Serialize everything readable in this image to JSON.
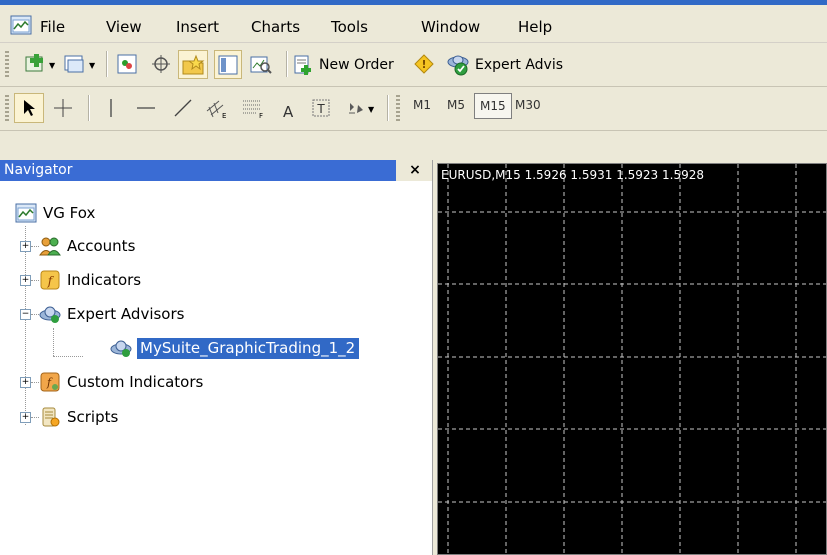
{
  "menubar": {
    "items": [
      "File",
      "View",
      "Insert",
      "Charts",
      "Tools",
      "Window",
      "Help"
    ]
  },
  "toolbar_standard": {
    "new_order_label": "New Order",
    "expert_advisors_label": "Expert Advis"
  },
  "toolbar_periods": {
    "periods": [
      "M1",
      "M5",
      "M15",
      "M30"
    ],
    "active_period": "M15",
    "text_tool_label": "A"
  },
  "navigator": {
    "title": "Navigator",
    "close_glyph": "×",
    "root": "VG Fox",
    "items": [
      {
        "label": "Accounts",
        "icon": "accounts-icon",
        "expander": "+"
      },
      {
        "label": "Indicators",
        "icon": "indicators-icon",
        "expander": "+"
      },
      {
        "label": "Expert Advisors",
        "icon": "expert-advisors-icon",
        "expander": "−"
      },
      {
        "label": "MySuite_GraphicTrading_1_2",
        "icon": "expert-advisor-item-icon",
        "selected": true
      },
      {
        "label": "Custom Indicators",
        "icon": "custom-indicators-icon",
        "expander": "+"
      },
      {
        "label": "Scripts",
        "icon": "scripts-icon",
        "expander": "+"
      }
    ]
  },
  "chart": {
    "header": "EURUSD,M15  1.5926 1.5931 1.5923 1.5928",
    "background": "#000000",
    "grid_color": "#c0c0c0"
  },
  "colors": {
    "selection": "#3169c6",
    "navigator_title_bg": "#3a6cd4",
    "toolbar_bg": "#ece9d8"
  }
}
